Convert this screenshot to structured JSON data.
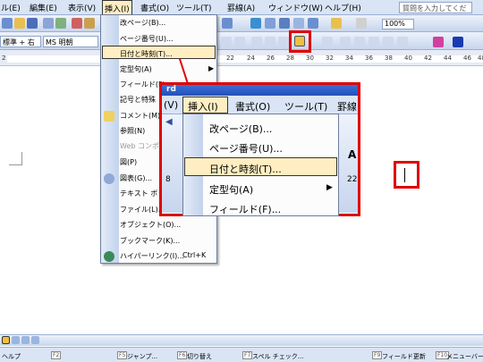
{
  "menubar": {
    "items": [
      "ル(E)",
      "編集(E)",
      "表示(V)",
      "挿入(I)",
      "書式(O)",
      "ツール(T)",
      "罫線(A)",
      "ウィンドウ(W)",
      "ヘルプ(H)"
    ],
    "help_placeholder": "質問を入力してください"
  },
  "toolbar": {
    "zoom": "100%",
    "style": "標準 + 右",
    "font": "MS 明朝"
  },
  "ruler": {
    "ticks": [
      "2",
      "22",
      "24",
      "26",
      "28",
      "30",
      "32",
      "34",
      "36",
      "38",
      "40",
      "42",
      "44",
      "46",
      "48"
    ]
  },
  "menu": {
    "items": [
      {
        "label": "改ページ(B)...",
        "disabled": false
      },
      {
        "label": "ページ番号(U)...",
        "disabled": false
      },
      {
        "label": "日付と時刻(T)...",
        "disabled": false
      },
      {
        "label": "定型句(A)",
        "disabled": false
      },
      {
        "label": "フィールド(F)...",
        "disabled": false
      },
      {
        "label": "記号と特殊",
        "disabled": false
      },
      {
        "label": "コメント(M)",
        "disabled": false
      },
      {
        "label": "参照(N)",
        "disabled": false
      },
      {
        "label": "Web コンポー",
        "disabled": true
      },
      {
        "label": "図(P)",
        "disabled": false
      },
      {
        "label": "図表(G)...",
        "disabled": false
      },
      {
        "label": "テキスト ボッ",
        "disabled": false
      },
      {
        "label": "ファイル(L)...",
        "disabled": false
      },
      {
        "label": "オブジェクト(O)...",
        "disabled": false
      },
      {
        "label": "ブックマーク(K)...",
        "disabled": false
      },
      {
        "label": "ハイパーリンク(I)...",
        "disabled": false
      }
    ],
    "hyperlink_shortcut": "Ctrl+K"
  },
  "zoom": {
    "title": "rd",
    "menubar": [
      "(V)",
      "挿入(I)",
      "書式(O)",
      "ツール(T)",
      "罫線"
    ],
    "items": [
      "改ページ(B)...",
      "ページ番号(U)...",
      "日付と時刻(T)...",
      "定型句(A)",
      "フィールド(F)..."
    ],
    "toolbar_num_left": "8",
    "toolbar_num_right": "22",
    "toolbar_letter": "A"
  },
  "fkeys": [
    {
      "num": "",
      "label": "ヘルプ"
    },
    {
      "num": "F2",
      "label": ""
    },
    {
      "num": "F5",
      "label": "ジャンプ..."
    },
    {
      "num": "F6",
      "label": "切り替え"
    },
    {
      "num": "F7",
      "label": "スペル チェック..."
    },
    {
      "num": "F9",
      "label": "フィールド更新"
    },
    {
      "num": "F10",
      "label": "メニューバー"
    }
  ]
}
